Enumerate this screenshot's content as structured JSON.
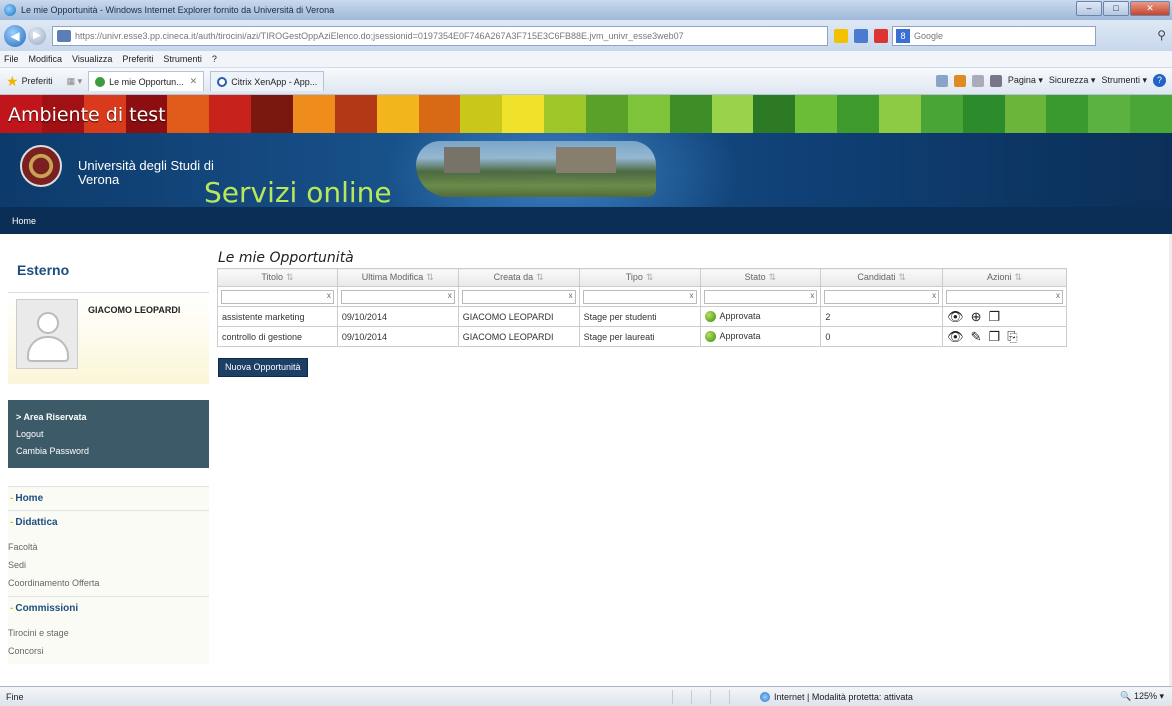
{
  "window": {
    "title": "Le mie Opportunità - Windows Internet Explorer fornito da Università di Verona",
    "url": "https://univr.esse3.pp.cineca.it/auth/tirocini/azi/TIROGestOppAziElenco.do;jsessionid=0197354E0F746A267A3F715E3C6FB88E.jvm_univr_esse3web07",
    "search_engine": "Google"
  },
  "menu": [
    "File",
    "Modifica",
    "Visualizza",
    "Preferiti",
    "Strumenti",
    "?"
  ],
  "favorites": {
    "label": "Preferiti",
    "tabs": [
      "Le mie Opportun...",
      "Citrix XenApp - App..."
    ]
  },
  "commands": [
    "Pagina ▾",
    "Sicurezza ▾",
    "Strumenti ▾"
  ],
  "banner": {
    "test_label": "Ambiente di test",
    "university": "Università degli Studi di Verona",
    "servizi": "Servizi online",
    "stripes": [
      "#c0161b",
      "#a11013",
      "#d93a1b",
      "#8c0e10",
      "#e05a1a",
      "#c7231a",
      "#7a1810",
      "#ee8c1c",
      "#b23816",
      "#f2b51c",
      "#d86a16",
      "#c9c81a",
      "#f0e22b",
      "#9fc628",
      "#5aa12a",
      "#7dc43a",
      "#3d8e27",
      "#9ad24a",
      "#2c7a24",
      "#6bbd38",
      "#3e9a2c",
      "#8ecb45",
      "#4aa634",
      "#2c8b2a",
      "#6ab53a",
      "#3a9a30",
      "#5bb240",
      "#4aa636"
    ]
  },
  "home_bar": "Home",
  "sidebar": {
    "role": "Esterno",
    "user_name": "GIACOMO LEOPARDI",
    "reserved": [
      "Area Riservata",
      "Logout",
      "Cambia Password"
    ],
    "nav": [
      {
        "label": "Home",
        "items": []
      },
      {
        "label": "Didattica",
        "items": [
          "Facoltà",
          "Sedi",
          "Coordinamento Offerta"
        ]
      },
      {
        "label": "Commissioni",
        "items": [
          "Tirocini e stage",
          "Concorsi"
        ]
      }
    ]
  },
  "main": {
    "heading": "Le mie Opportunità",
    "columns": [
      "Titolo",
      "Ultima Modifica",
      "Creata da",
      "Tipo",
      "Stato",
      "Candidati",
      "Azioni"
    ],
    "rows": [
      {
        "titolo": "assistente marketing",
        "data": "09/10/2014",
        "creata_da": "GIACOMO LEOPARDI",
        "tipo": "Stage per studenti",
        "stato": "Approvata",
        "candidati": "2",
        "actions": [
          "view-icon",
          "zoom-icon",
          "copy-icon"
        ]
      },
      {
        "titolo": "controllo di gestione",
        "data": "09/10/2014",
        "creata_da": "GIACOMO LEOPARDI",
        "tipo": "Stage per laureati",
        "stato": "Approvata",
        "candidati": "0",
        "actions": [
          "view-icon",
          "edit-icon",
          "copy-icon",
          "export-icon"
        ]
      }
    ],
    "new_button": "Nuova Opportunità"
  },
  "status_bar": {
    "left": "Fine",
    "zone": "Internet | Modalità protetta: attivata",
    "zoom": "125%"
  }
}
